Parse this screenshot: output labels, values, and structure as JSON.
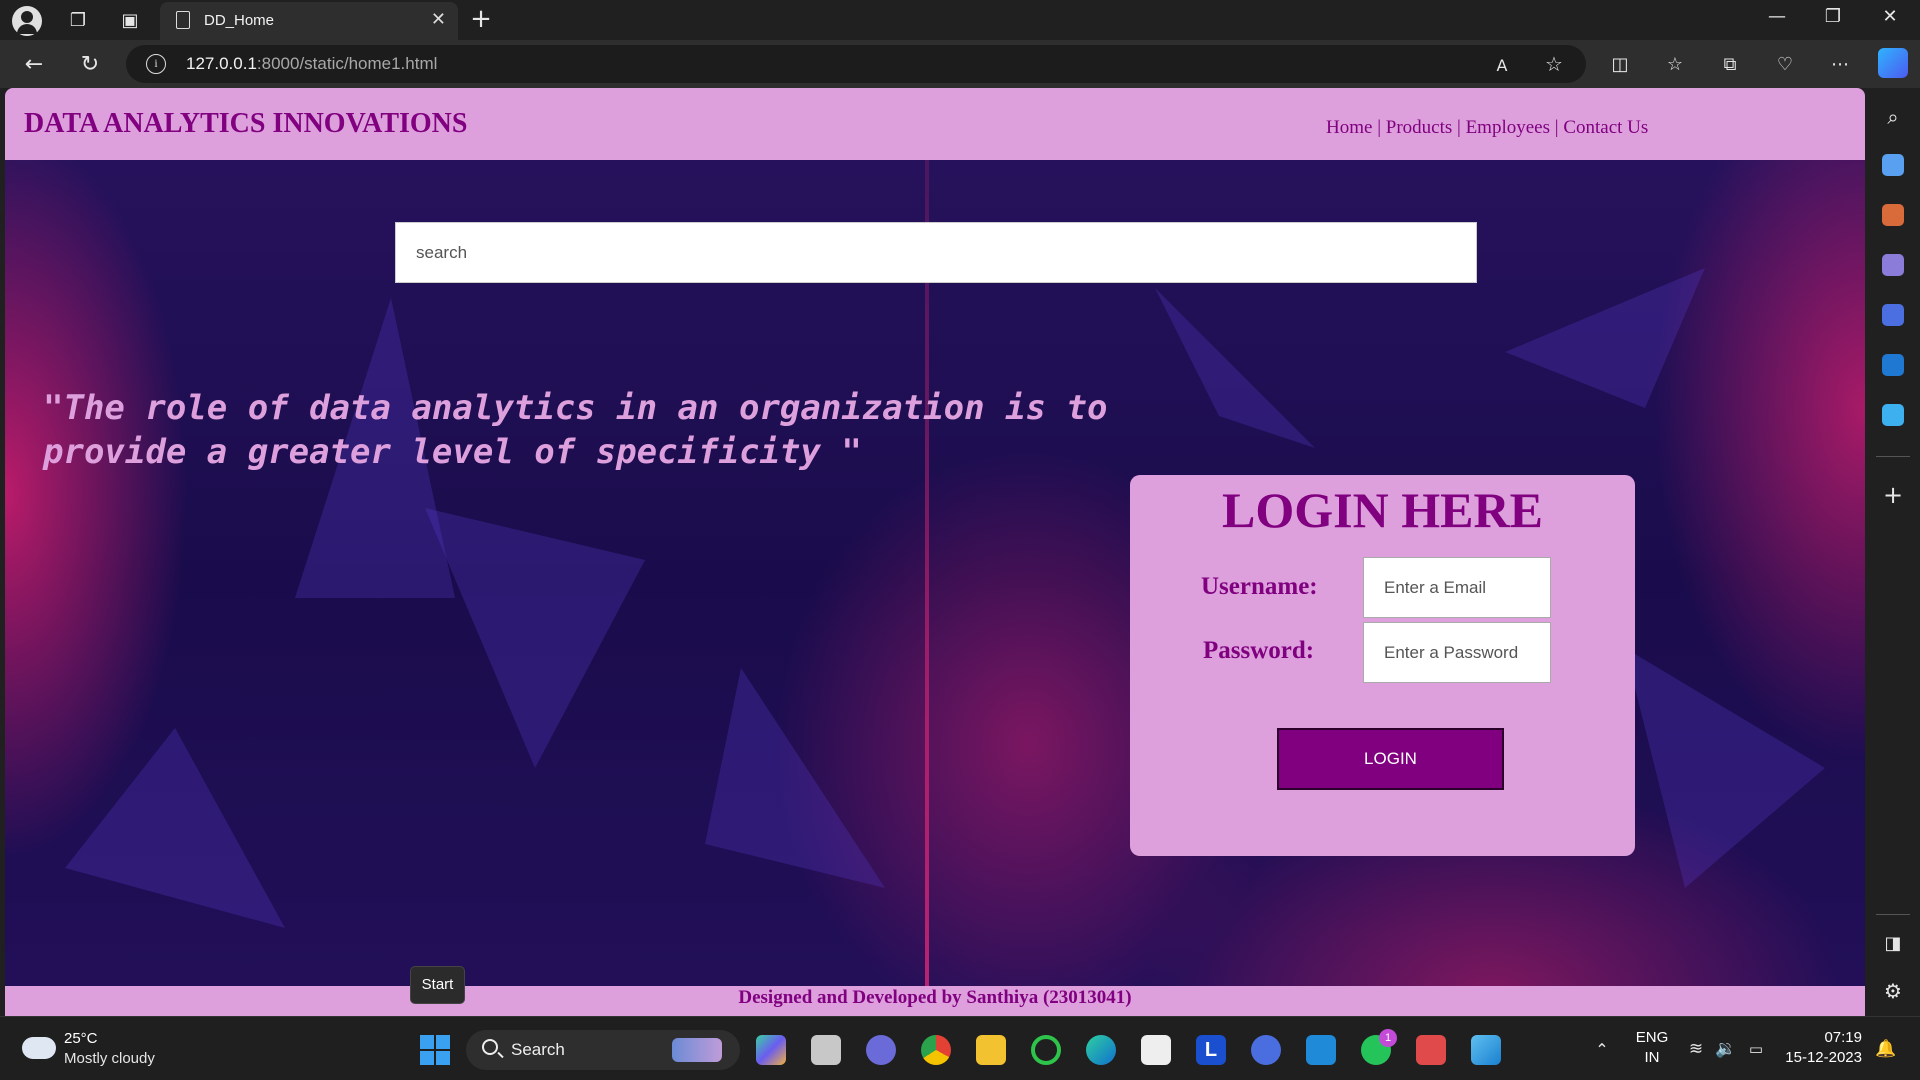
{
  "browser": {
    "tab_title": "DD_Home",
    "url_host": "127.0.0.1",
    "url_rest": ":8000/static/home1.html"
  },
  "site": {
    "title": "DATA ANALYTICS INNOVATIONS",
    "nav": [
      "Home",
      "Products",
      "Employees",
      "Contact Us"
    ],
    "nav_separator": "|",
    "search_placeholder": "search",
    "quote": "\"The role of data analytics in an organization is to provide a greater level of specificity \"",
    "login": {
      "title": "LOGIN HERE",
      "username_label": "Username:",
      "username_placeholder": "Enter a Email",
      "password_label": "Password:",
      "password_placeholder": "Enter a Password",
      "button_label": "LOGIN"
    },
    "footer": "Designed and Developed by Santhiya (23013041)",
    "colors": {
      "header_bg": "#dda0dd",
      "brand": "#800080"
    }
  },
  "tooltip": {
    "start": "Start"
  },
  "taskbar": {
    "temperature": "25°C",
    "weather": "Mostly cloudy",
    "search_label": "Search",
    "language": "ENG",
    "region": "IN",
    "time": "07:19",
    "date": "15-12-2023",
    "whatsapp_badge": "1",
    "pinned_apps": [
      "copilot-app-icon",
      "task-view-icon",
      "teams-icon",
      "chrome-icon",
      "file-explorer-icon",
      "circle-app-icon",
      "edge-icon",
      "store-icon",
      "l-app-icon",
      "nordvpn-icon",
      "vscode-icon",
      "whatsapp-icon",
      "snipping-tool-icon",
      "photos-icon"
    ]
  }
}
